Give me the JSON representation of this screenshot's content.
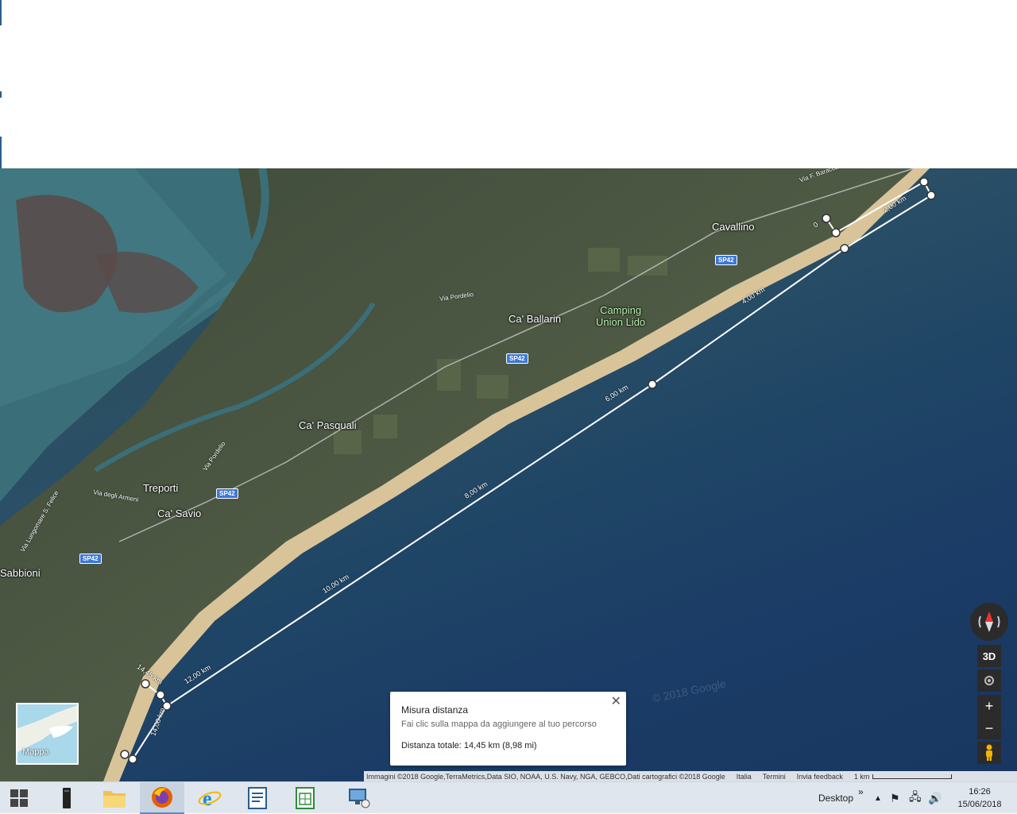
{
  "map": {
    "places": {
      "cavallino": "Cavallino",
      "ca_ballarin": "Ca' Ballarin",
      "camping": "Camping\nUnion Lido",
      "ca_pasquali": "Ca' Pasquali",
      "treporti": "Treporti",
      "ca_savio": "Ca' Savio",
      "sabbioni": "Sabbioni"
    },
    "roads": {
      "via_pordelio_top": "Via Pordelio",
      "via_pordelio_left": "Via Pordelio",
      "via_armeni": "Via degli Armeni",
      "via_f_baracca": "Via F. Baracca",
      "via_lungomare": "Via Lungomare S. Felice"
    },
    "shields": {
      "sp42_a": "SP42",
      "sp42_b": "SP42",
      "sp42_c": "SP42",
      "sp42_d": "SP42"
    },
    "measure_labels": {
      "km0": "0",
      "km2": "2,00 km",
      "km4": "4,00 km",
      "km6": "6,00 km",
      "km8": "8,00 km",
      "km10": "10,00 km",
      "km12": "12,00 km",
      "km14": "14,00 km",
      "km1445": "14,45 km"
    },
    "watermark": "© 2018 Google"
  },
  "controls": {
    "threed": "3D",
    "zoom_in": "+",
    "zoom_out": "−",
    "minimap_label": "Mappa"
  },
  "measure_panel": {
    "title": "Misura distanza",
    "subtitle": "Fai clic sulla mappa da aggiungere al tuo percorso",
    "total": "Distanza totale: 14,45 km (8,98 mi)",
    "close": "✕"
  },
  "attribution": {
    "imagery": "Immagini ©2018 Google,TerraMetrics,Data SIO, NOAA, U.S. Navy, NGA, GEBCO,Dati cartografici ©2018 Google",
    "country": "Italia",
    "terms": "Termini",
    "feedback": "Invia feedback",
    "scale": "1 km"
  },
  "taskbar": {
    "desktop_label": "Desktop",
    "chevron": "»",
    "time": "16:26",
    "date": "15/06/2018"
  },
  "colors": {
    "measure_line": "#ffffff",
    "shield_blue": "#3d79d6",
    "camping_green": "#b9f3b0"
  }
}
